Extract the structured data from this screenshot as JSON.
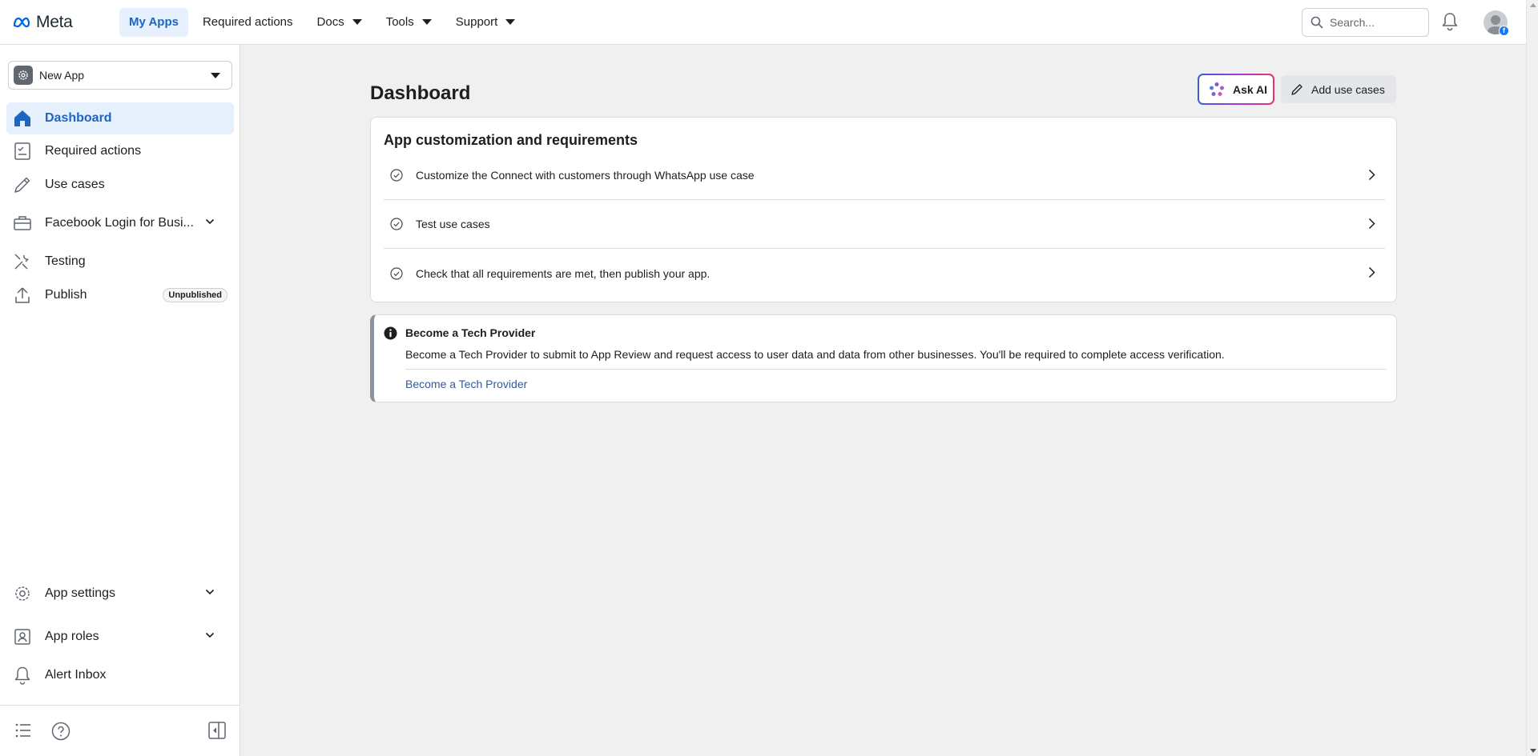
{
  "header": {
    "logo_text": "Meta",
    "nav": [
      {
        "label": "My Apps",
        "active": true,
        "dropdown": false
      },
      {
        "label": "Required actions",
        "active": false,
        "dropdown": false
      },
      {
        "label": "Docs",
        "active": false,
        "dropdown": true
      },
      {
        "label": "Tools",
        "active": false,
        "dropdown": true
      },
      {
        "label": "Support",
        "active": false,
        "dropdown": true
      }
    ],
    "search_placeholder": "Search..."
  },
  "sidebar": {
    "app_name": "New App",
    "items": [
      {
        "label": "Dashboard",
        "icon": "home-icon",
        "active": true
      },
      {
        "label": "Required actions",
        "icon": "checklist-icon"
      },
      {
        "label": "Use cases",
        "icon": "pencil-icon"
      },
      {
        "label": "Facebook Login for Busi...",
        "icon": "briefcase-icon",
        "expandable": true
      },
      {
        "label": "Testing",
        "icon": "tools-icon"
      },
      {
        "label": "Publish",
        "icon": "upload-icon",
        "badge": "Unpublished"
      }
    ],
    "bottom_items": [
      {
        "label": "App settings",
        "icon": "gear-icon",
        "expandable": true
      },
      {
        "label": "App roles",
        "icon": "person-badge-icon",
        "expandable": true
      },
      {
        "label": "Alert Inbox",
        "icon": "bell-icon"
      }
    ]
  },
  "main": {
    "title": "Dashboard",
    "ask_ai_label": "Ask AI",
    "add_use_cases_label": "Add use cases",
    "requirements": {
      "title": "App customization and requirements",
      "rows": [
        "Customize the Connect with customers through WhatsApp use case",
        "Test use cases",
        "Check that all requirements are met, then publish your app."
      ]
    },
    "tech_provider": {
      "title": "Become a Tech Provider",
      "body": "Become a Tech Provider to submit to App Review and request access to user data and data from other businesses. You'll be required to complete access verification.",
      "link": "Become a Tech Provider"
    }
  },
  "colors": {
    "accent": "#1d65c1",
    "active_bg": "#e7f0fd",
    "link": "#385898"
  }
}
